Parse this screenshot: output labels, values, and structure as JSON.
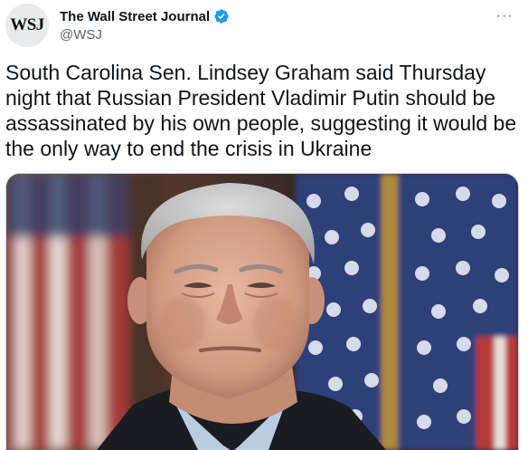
{
  "account": {
    "avatar_text": "WSJ",
    "display_name": "The Wall Street Journal",
    "handle": "@WSJ",
    "verified": true
  },
  "more_icon": "···",
  "tweet": {
    "text": "South Carolina Sen. Lindsey Graham said Thursday night that Russian President Vladimir Putin should be assassinated by his own people, suggesting it would be the only way to end the crisis in Ukraine"
  },
  "media": {
    "description_icon": "photo-portrait-with-flag-background"
  },
  "colors": {
    "verified": "#1d9bf0",
    "handle": "#536471",
    "text": "#0f1419"
  }
}
